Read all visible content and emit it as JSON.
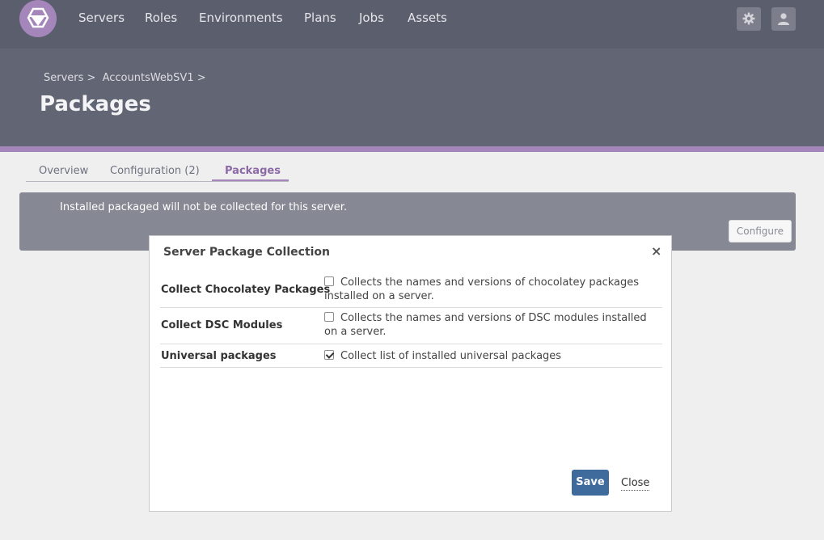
{
  "nav": {
    "items": [
      {
        "label": "Servers"
      },
      {
        "label": "Roles"
      },
      {
        "label": "Environments"
      },
      {
        "label": "Plans"
      },
      {
        "label": "Jobs"
      },
      {
        "label": "Assets"
      }
    ],
    "icons": [
      "gear-icon",
      "user-icon"
    ]
  },
  "breadcrumb": [
    "Servers >",
    "AccountsWebSV1 >"
  ],
  "page_title": "Packages",
  "tabs": [
    {
      "label": "Overview",
      "active": false
    },
    {
      "label": "Configuration (2)",
      "active": false
    },
    {
      "label": "Packages",
      "active": true
    }
  ],
  "alert": {
    "message": "Installed packaged will not be collected for this server.",
    "configure_label": "Configure"
  },
  "modal": {
    "title": "Server Package Collection",
    "close_glyph": "×",
    "rows": [
      {
        "label": "Collect Chocolatey Packages",
        "description": "Collects the names and versions of chocolatey packages installed on a server.",
        "checked": false
      },
      {
        "label": "Collect DSC Modules",
        "description": "Collects the names and versions of DSC modules installed on a server.",
        "checked": false
      },
      {
        "label": "Universal packages",
        "description": "Collect list of installed universal packages",
        "checked": true
      }
    ],
    "save_label": "Save",
    "close_label": "Close"
  },
  "colors": {
    "nav_bg": "#5b5e6d",
    "header_bg": "#626573",
    "accent_purple": "#a486ba",
    "save_blue": "#3f6a9c"
  }
}
